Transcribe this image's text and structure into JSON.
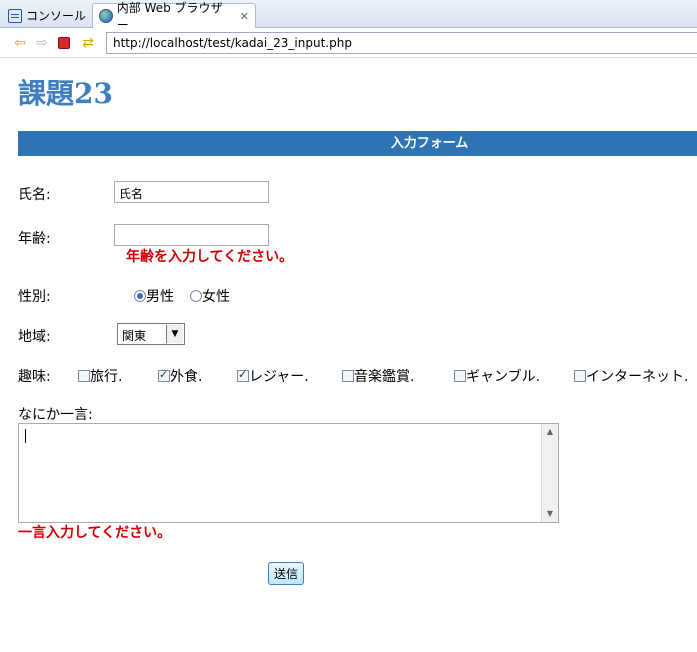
{
  "tabs": [
    {
      "label": "コンソール"
    },
    {
      "label": "内部 Web ブラウザー"
    }
  ],
  "toolbar": {
    "url": "http://localhost/test/kadai_23_input.php"
  },
  "page": {
    "title": "課題23",
    "form_header": "入力フォーム"
  },
  "form": {
    "name_label": "氏名:",
    "name_value": "氏名",
    "age_label": "年齢:",
    "age_value": "",
    "age_error": "年齢を入力してください。",
    "gender_label": "性別:",
    "gender_options": [
      {
        "label": "男性",
        "checked": true
      },
      {
        "label": "女性",
        "checked": false
      }
    ],
    "region_label": "地域:",
    "region_selected": "関東",
    "hobby_label": "趣味:",
    "hobbies": [
      {
        "label": "旅行.",
        "checked": false
      },
      {
        "label": "外食.",
        "checked": true
      },
      {
        "label": "レジャー.",
        "checked": true
      },
      {
        "label": "音楽鑑賞.",
        "checked": false
      },
      {
        "label": "ギャンブル.",
        "checked": false
      },
      {
        "label": "インターネット.",
        "checked": false
      }
    ],
    "comment_label": "なにか一言:",
    "comment_value": "",
    "comment_error": "一言入力してください。",
    "submit_label": "送信"
  }
}
